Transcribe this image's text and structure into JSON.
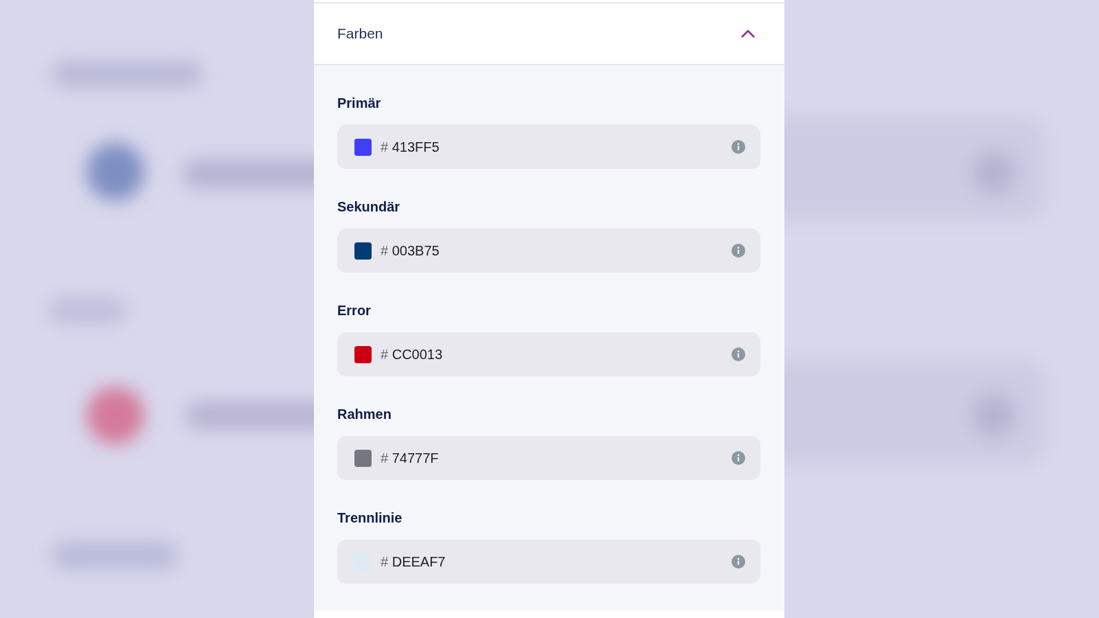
{
  "section": {
    "title": "Farben",
    "expanded": true,
    "fields": [
      {
        "label": "Primär",
        "prefix": "#",
        "value": "413FF5",
        "color": "#413ff5"
      },
      {
        "label": "Sekundär",
        "prefix": "#",
        "value": "003B75",
        "color": "#003b75"
      },
      {
        "label": "Error",
        "prefix": "#",
        "value": "CC0013",
        "color": "#cc0013"
      },
      {
        "label": "Rahmen",
        "prefix": "#",
        "value": "74777F",
        "color": "#74777f"
      },
      {
        "label": "Trennlinie",
        "prefix": "#",
        "value": "DEEAF7",
        "color": "#deeaf7"
      }
    ]
  }
}
